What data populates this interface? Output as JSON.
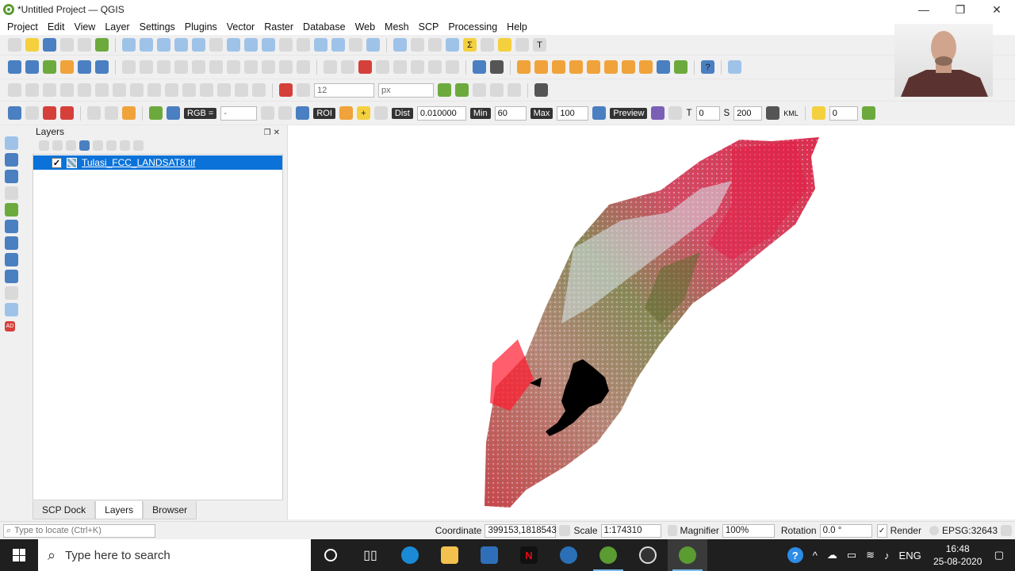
{
  "window": {
    "title": "*Untitled Project — QGIS",
    "minimize": "—",
    "maximize": "❐",
    "close": "✕"
  },
  "menu": [
    "Project",
    "Edit",
    "View",
    "Layer",
    "Settings",
    "Plugins",
    "Vector",
    "Raster",
    "Database",
    "Web",
    "Mesh",
    "SCP",
    "Processing",
    "Help"
  ],
  "label_toolbar": {
    "font_size": "12",
    "unit": "px"
  },
  "scp_toolbar": {
    "band_set": "RGB =",
    "band_value": "-",
    "roi_label": "ROI",
    "dist_label": "Dist",
    "dist_value": "0.010000",
    "min_label": "Min",
    "min_value": "60",
    "max_label": "Max",
    "max_value": "100",
    "preview_label": "Preview",
    "t_label": "T",
    "t_value": "0",
    "s_label": "S",
    "s_value": "200",
    "kml_label": "KML",
    "extra_value": "0"
  },
  "layers_panel": {
    "title": "Layers",
    "layer": {
      "name": "Tulasi_FCC_LANDSAT8.tif",
      "checked": "✓"
    },
    "tabs": [
      "SCP Dock",
      "Layers",
      "Browser"
    ]
  },
  "status": {
    "locator_placeholder": "Type to locate (Ctrl+K)",
    "coordinate_label": "Coordinate",
    "coordinate_value": "399153,1818543",
    "scale_label": "Scale",
    "scale_value": "1:174310",
    "magnifier_label": "Magnifier",
    "magnifier_value": "100%",
    "rotation_label": "Rotation",
    "rotation_value": "0.0 °",
    "render_label": "Render",
    "crs": "EPSG:32643"
  },
  "taskbar": {
    "search_placeholder": "Type here to search",
    "language": "ENG",
    "time": "16:48",
    "date": "25-08-2020"
  }
}
